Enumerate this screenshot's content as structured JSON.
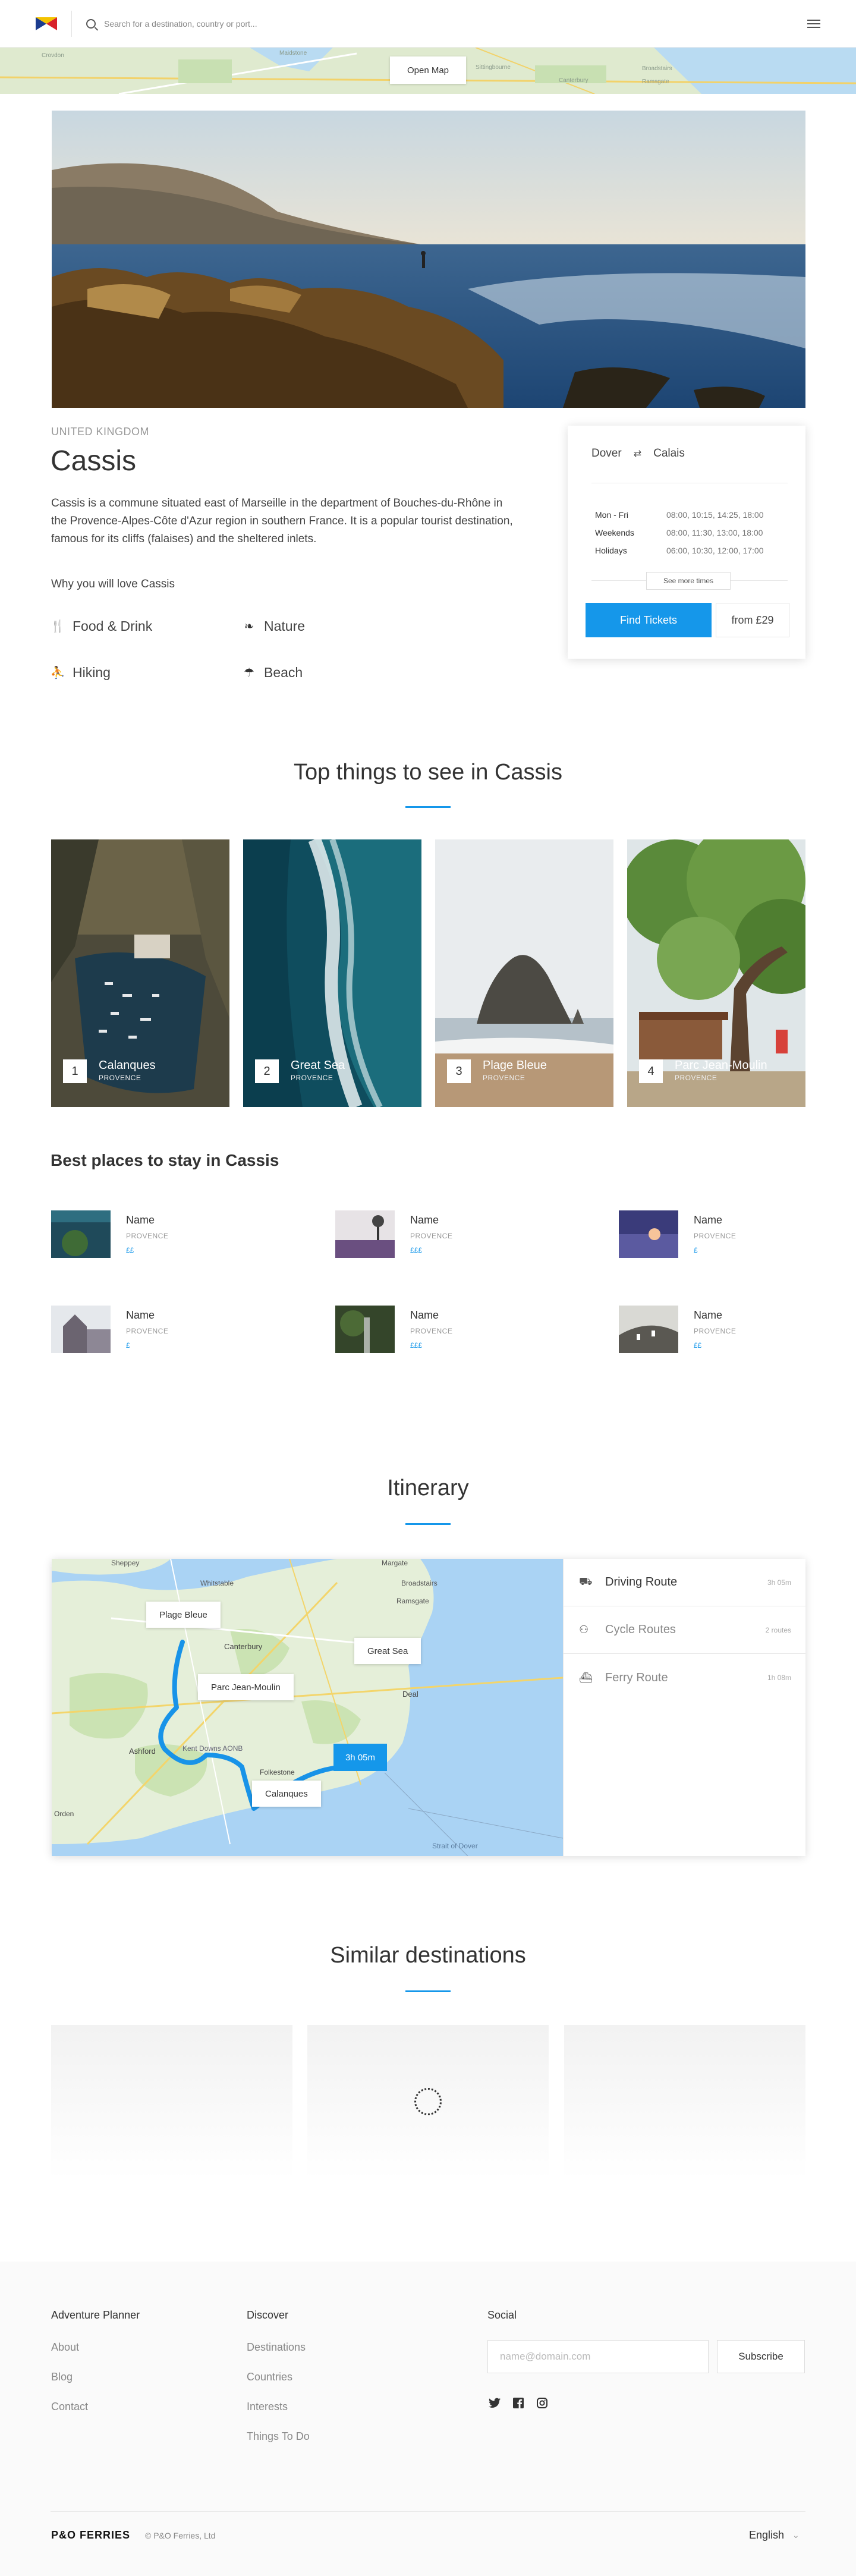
{
  "header": {
    "search_placeholder": "Search for a destination, country or port..."
  },
  "map_strip": {
    "open_map_label": "Open Map",
    "places": [
      "Crovdon",
      "Maidstone",
      "Sittingbourne",
      "Canterbury",
      "Broadstairs",
      "Ramsgate"
    ]
  },
  "destination": {
    "country": "UNITED KINGDOM",
    "name": "Cassis",
    "description": "Cassis is a commune situated east of Marseille in the department of Bouches-du-Rhône in the Provence-Alpes-Côte d'Azur region in southern France. It is a popular tourist destination, famous for its cliffs (falaises) and the sheltered inlets.",
    "why_heading": "Why you will love Cassis",
    "features": [
      {
        "label": "Food & Drink",
        "icon": "fork-knife-icon"
      },
      {
        "label": "Nature",
        "icon": "leaf-icon"
      },
      {
        "label": "Hiking",
        "icon": "hiker-icon"
      },
      {
        "label": "Beach",
        "icon": "umbrella-icon"
      }
    ]
  },
  "ticket": {
    "from": "Dover",
    "to": "Calais",
    "schedule": [
      {
        "day": "Mon - Fri",
        "times": "08:00, 10:15, 14:25, 18:00"
      },
      {
        "day": "Weekends",
        "times": "08:00, 11:30, 13:00, 18:00"
      },
      {
        "day": "Holidays",
        "times": "06:00, 10:30, 12:00, 17:00"
      }
    ],
    "see_more_label": "See more times",
    "find_label": "Find Tickets",
    "price_label": "from £29",
    "accent": "#1597ea"
  },
  "top_things": {
    "title": "Top things to see in Cassis",
    "items": [
      {
        "num": "1",
        "name": "Calanques",
        "region": "PROVENCE"
      },
      {
        "num": "2",
        "name": "Great Sea",
        "region": "PROVENCE"
      },
      {
        "num": "3",
        "name": "Plage Bleue",
        "region": "PROVENCE"
      },
      {
        "num": "4",
        "name": "Parc Jean-Moulin",
        "region": "PROVENCE"
      }
    ]
  },
  "stays": {
    "title": "Best places to stay in Cassis",
    "items": [
      {
        "name": "Name",
        "region": "PROVENCE",
        "price": "££"
      },
      {
        "name": "Name",
        "region": "PROVENCE",
        "price": "£££"
      },
      {
        "name": "Name",
        "region": "PROVENCE",
        "price": "£"
      },
      {
        "name": "Name",
        "region": "PROVENCE",
        "price": "£"
      },
      {
        "name": "Name",
        "region": "PROVENCE",
        "price": "£££"
      },
      {
        "name": "Name",
        "region": "PROVENCE",
        "price": "££"
      }
    ]
  },
  "itinerary": {
    "title": "Itinerary",
    "pins": [
      "Plage Bleue",
      "Great Sea",
      "Parc Jean-Moulin",
      "Calanques"
    ],
    "duration_badge": "3h 05m",
    "map_labels": [
      "Sheppey",
      "Whitstable",
      "Margate",
      "Broadstairs",
      "Ramsgate",
      "Canterbury",
      "Deal",
      "Ashford",
      "Kent Downs AONB",
      "Folkestone",
      "Orden",
      "Strait of Dover"
    ],
    "routes": [
      {
        "name": "Driving Route",
        "time": "3h 05m",
        "icon": "car-icon"
      },
      {
        "name": "Cycle Routes",
        "time": "2 routes",
        "icon": "bicycle-icon"
      },
      {
        "name": "Ferry Route",
        "time": "1h 08m",
        "icon": "ferry-icon"
      }
    ]
  },
  "similar": {
    "title": "Similar destinations"
  },
  "footer": {
    "col1": {
      "heading": "Adventure Planner",
      "links": [
        "About",
        "Blog",
        "Contact"
      ]
    },
    "col2": {
      "heading": "Discover",
      "links": [
        "Destinations",
        "Countries",
        "Interests",
        "Things To Do"
      ]
    },
    "social": {
      "heading": "Social",
      "email_placeholder": "name@domain.com",
      "subscribe_label": "Subscribe"
    },
    "brand": "P&O FERRIES",
    "copyright": "© P&O Ferries, Ltd",
    "language": "English"
  }
}
